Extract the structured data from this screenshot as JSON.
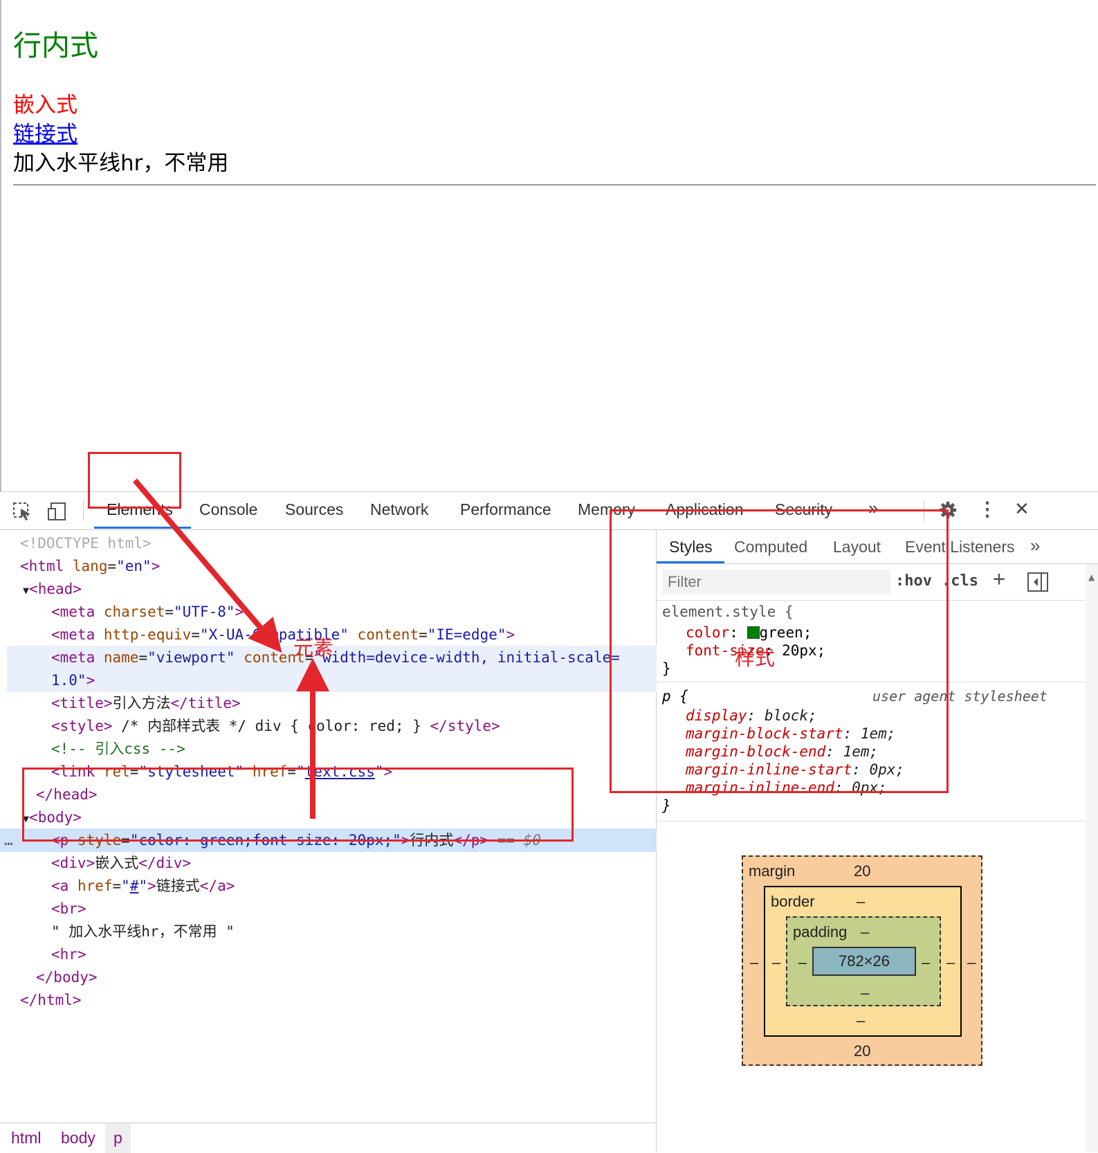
{
  "viewport": {
    "inline_text": "行内式",
    "embedded_text": "嵌入式",
    "link_text": "链接式",
    "plain_text": "加入水平线hr，不常用"
  },
  "toolbar": {
    "tabs": [
      "Elements",
      "Console",
      "Sources",
      "Network",
      "Performance",
      "Memory",
      "Application",
      "Security"
    ],
    "more": "»",
    "menu": "⋮",
    "close": "✕"
  },
  "dom": {
    "doctype": "<!DOCTYPE html>",
    "html_open": "html",
    "lang_attr": "lang",
    "lang_val": "\"en\"",
    "head": "head",
    "meta_charset_attr": "charset",
    "meta_charset_val": "\"UTF-8\"",
    "meta_http_attr": "http-equiv",
    "meta_http_val": "\"X-UA-Compatible\"",
    "content_attr": "content",
    "meta_http_content": "\"IE=edge\"",
    "name_attr": "name",
    "name_val": "\"viewport\"",
    "viewport_content": "\"width=device-width, initial-scale=",
    "viewport_content_2": "1.0\"",
    "title_text": "引入方法",
    "style_text": " /* 内部样式表 */ div { color: red; } ",
    "comment": "<!-- 引入css -->",
    "rel_attr": "rel",
    "rel_val": "\"stylesheet\"",
    "href_attr": "href",
    "href_val": "text.css",
    "body": "body",
    "p_style_attr": "style",
    "p_style_val": "\"color: green;font-size: 20px;\"",
    "p_text": "行内式",
    "selected_marker": "== $0",
    "div_text": "嵌入式",
    "a_href": "#",
    "a_text": "链接式",
    "br": "br",
    "text_node": "\" 加入水平线hr，不常用 \"",
    "hr": "hr",
    "ellipsis": "…"
  },
  "breadcrumbs": [
    "html",
    "body",
    "p"
  ],
  "styles": {
    "tabs": [
      "Styles",
      "Computed",
      "Layout",
      "Event Listeners"
    ],
    "more": "»",
    "filter_placeholder": "Filter",
    "hov": ":hov",
    "cls": ".cls",
    "plus": "+",
    "element_selector": "element.style {",
    "element_rules": [
      {
        "prop": "color",
        "value": "green;"
      },
      {
        "prop": "font-size",
        "value": "20px;"
      }
    ],
    "close_brace": "}",
    "p_selector": "p {",
    "p_source": "user agent stylesheet",
    "p_rules": [
      {
        "prop": "display",
        "value": "block;"
      },
      {
        "prop": "margin-block-start",
        "value": "1em;"
      },
      {
        "prop": "margin-block-end",
        "value": "1em;"
      },
      {
        "prop": "margin-inline-start",
        "value": "0px;"
      },
      {
        "prop": "margin-inline-end",
        "value": "0px;"
      }
    ]
  },
  "box_model": {
    "margin_label": "margin",
    "margin_top": "20",
    "margin_bottom": "20",
    "margin_side": "–",
    "border_label": "border",
    "border_val": "–",
    "padding_label": "padding",
    "padding_val": "–",
    "content": "782×26"
  },
  "annotations": {
    "elements_label": "元素",
    "styles_label": "样式"
  },
  "colors": {
    "swatch": "#008000",
    "annotation_red": "#e3262b",
    "margin_fill": "#f9cc9d",
    "border_fill": "#fcdd9a",
    "padding_fill": "#c3d08b",
    "content_fill": "#8cb6c0"
  }
}
